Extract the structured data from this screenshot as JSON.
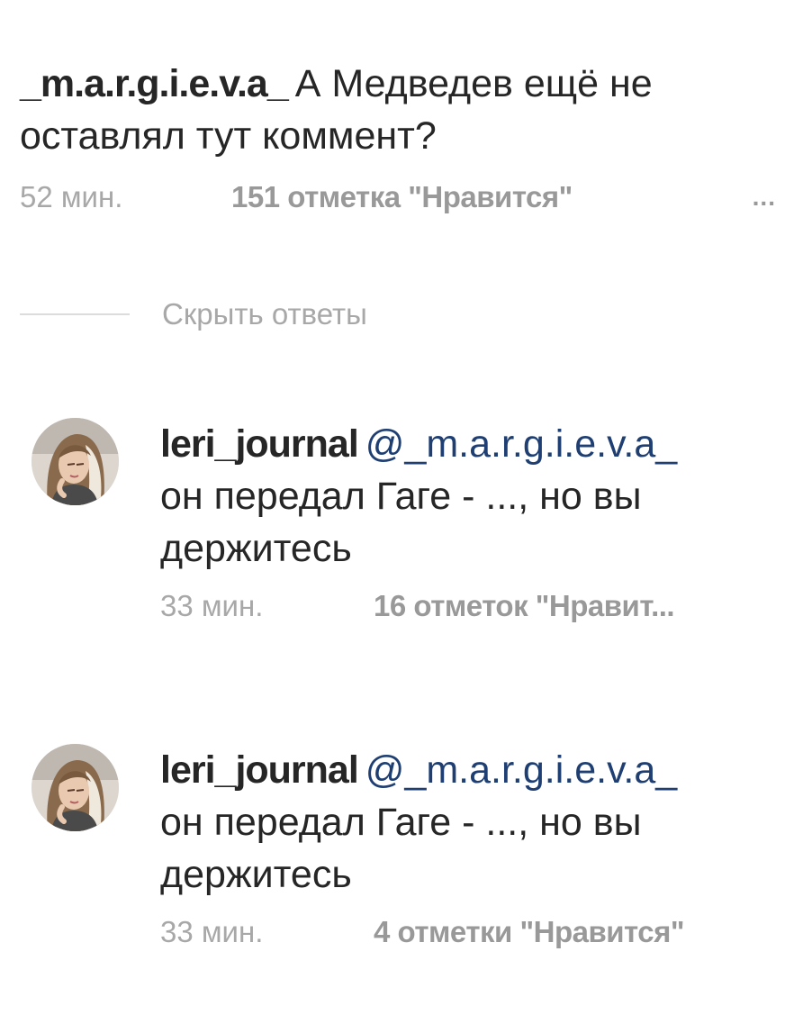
{
  "comment": {
    "username": "_m.a.r.g.i.e.v.a_",
    "text": "А Медведев ещё не оставлял тут коммент?",
    "time": "52 мин.",
    "likes": "151 отметка \"Нравится\"",
    "more": "..."
  },
  "replies_toggle": {
    "label": "Скрыть ответы"
  },
  "replies": [
    {
      "username": "leri_journal",
      "mention": "@_m.a.r.g.i.e.v.a_",
      "text": "он передал Гаге - ..., но вы держитесь",
      "time": "33 мин.",
      "likes": "16 отметок \"Нравит..."
    },
    {
      "username": "leri_journal",
      "mention": "@_m.a.r.g.i.e.v.a_",
      "text": "он передал Гаге - ..., но вы держитесь",
      "time": "33 мин.",
      "likes": "4 отметки \"Нравится\""
    }
  ]
}
